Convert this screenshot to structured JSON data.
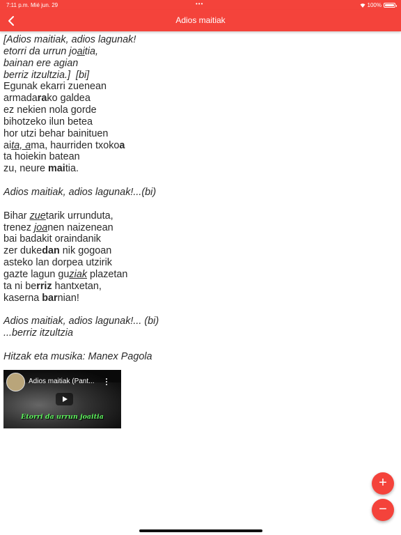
{
  "status": {
    "time": "7:11 p.m.",
    "date": "Mié jun. 29",
    "battery": "100%",
    "battery_level": 1.0
  },
  "header": {
    "title": "Adios maitiak"
  },
  "lyrics": [
    {
      "italic": true,
      "parts": [
        {
          "t": "[Adios maitiak, adios lagunak!"
        }
      ]
    },
    {
      "italic": true,
      "parts": [
        {
          "t": "etorri da urrun jo"
        },
        {
          "t": "ai",
          "u": true
        },
        {
          "t": "tia,"
        }
      ]
    },
    {
      "italic": true,
      "parts": [
        {
          "t": "bainan ere agian"
        }
      ]
    },
    {
      "italic": true,
      "parts": [
        {
          "t": "berriz itzultzia.]  [bi]"
        }
      ]
    },
    {
      "parts": [
        {
          "t": "Egunak ekarri zuenean"
        }
      ]
    },
    {
      "parts": [
        {
          "t": "armada"
        },
        {
          "t": "ra",
          "b": true
        },
        {
          "t": "ko galdea"
        }
      ]
    },
    {
      "parts": [
        {
          "t": "ez nekien nola gorde"
        }
      ]
    },
    {
      "parts": [
        {
          "t": "bihotzeko ilun betea"
        }
      ]
    },
    {
      "parts": [
        {
          "t": "hor utzi behar bainituen"
        }
      ]
    },
    {
      "parts": [
        {
          "t": "ai"
        },
        {
          "t": "ta, a",
          "u": true,
          "i": true
        },
        {
          "t": "ma, haurriden txoko"
        },
        {
          "t": "a",
          "b": true
        }
      ]
    },
    {
      "parts": [
        {
          "t": "ta hoiekin batean"
        }
      ]
    },
    {
      "parts": [
        {
          "t": "zu, neure "
        },
        {
          "t": "mai",
          "b": true
        },
        {
          "t": "tia."
        }
      ]
    },
    {
      "parts": []
    },
    {
      "italic": true,
      "parts": [
        {
          "t": "Adios maitiak, adios lagunak!...(bi)"
        }
      ]
    },
    {
      "parts": []
    },
    {
      "parts": [
        {
          "t": "Bihar "
        },
        {
          "t": "zue",
          "u": true,
          "i": true
        },
        {
          "t": "tarik urrunduta,"
        }
      ]
    },
    {
      "parts": [
        {
          "t": "trenez "
        },
        {
          "t": "joa",
          "u": true,
          "i": true
        },
        {
          "t": "nen naizenean"
        }
      ]
    },
    {
      "parts": [
        {
          "t": "bai badakit oraindanik"
        }
      ]
    },
    {
      "parts": [
        {
          "t": "zer duke"
        },
        {
          "t": "dan",
          "b": true
        },
        {
          "t": " nik gogoan"
        }
      ]
    },
    {
      "parts": [
        {
          "t": "asteko lan dorpea utzirik"
        }
      ]
    },
    {
      "parts": [
        {
          "t": "gazte lagun gu"
        },
        {
          "t": "ziak",
          "u": true,
          "i": true
        },
        {
          "t": " plazetan"
        }
      ]
    },
    {
      "parts": [
        {
          "t": "ta ni be"
        },
        {
          "t": "rriz",
          "b": true
        },
        {
          "t": " hantxetan,"
        }
      ]
    },
    {
      "parts": [
        {
          "t": "kaserna "
        },
        {
          "t": "bar",
          "b": true
        },
        {
          "t": "nian!"
        }
      ]
    },
    {
      "parts": []
    },
    {
      "italic": true,
      "parts": [
        {
          "t": "Adios maitiak, adios lagunak!... (bi)"
        }
      ]
    },
    {
      "italic": true,
      "parts": [
        {
          "t": "...berriz itzultzia"
        }
      ]
    },
    {
      "parts": []
    },
    {
      "italic": true,
      "parts": [
        {
          "t": "Hitzak eta musika: Manex Pagola"
        }
      ]
    }
  ],
  "video": {
    "title": "Adios maitiak (Pant...",
    "caption": "Etorri da urrun joaitia"
  },
  "fab": {
    "zoom_in": "+",
    "zoom_out": "−"
  },
  "colors": {
    "accent": "#f4433b"
  }
}
